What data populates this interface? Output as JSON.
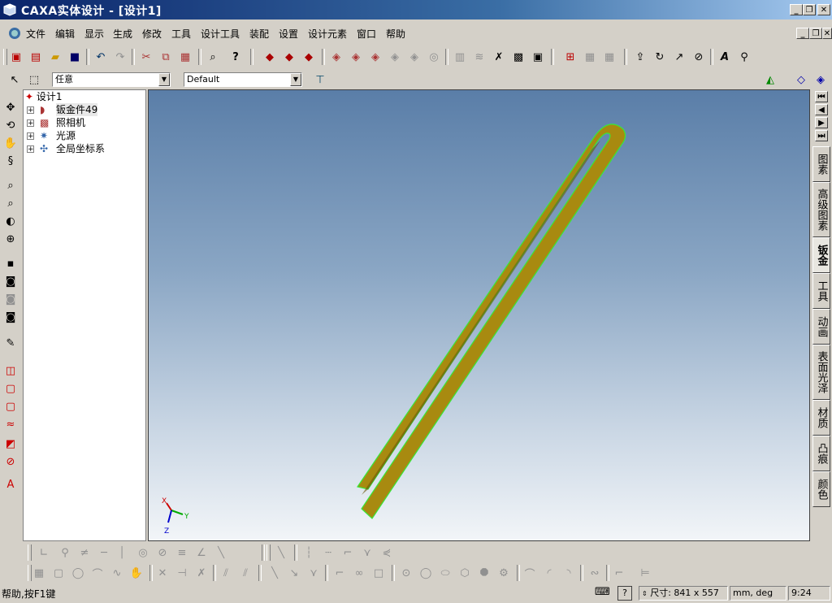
{
  "window": {
    "title": "CAXA实体设计 - [设计1]",
    "controls": [
      "_",
      "❐",
      "✕"
    ]
  },
  "menubar": {
    "items": [
      "文件",
      "编辑",
      "显示",
      "生成",
      "修改",
      "工具",
      "设计工具",
      "装配",
      "设置",
      "设计元素",
      "窗口",
      "帮助"
    ]
  },
  "toolbar2": {
    "filter_value": "任意",
    "view_value": "Default"
  },
  "tree": {
    "root": "设计1",
    "items": [
      {
        "label": "钣金件49",
        "icon": "sheet-metal-icon"
      },
      {
        "label": "照相机",
        "icon": "camera-icon"
      },
      {
        "label": "光源",
        "icon": "light-icon"
      },
      {
        "label": "全局坐标系",
        "icon": "coordinate-system-icon"
      }
    ]
  },
  "viewport": {
    "axes": {
      "x": "X",
      "y": "Y",
      "z": "Z"
    },
    "part_color": "#a88a10",
    "edge_color": "#38e838"
  },
  "right_tabs": {
    "items": [
      "图素",
      "高级图素",
      "钣金",
      "工具",
      "动画",
      "表面光泽",
      "材质",
      "凸痕",
      "颜色"
    ],
    "active": "钣金"
  },
  "statusbar": {
    "help_text": "帮助,按F1键",
    "size_text": "尺寸: 841 x 557",
    "units_text": "mm, deg",
    "time_text": "9:24"
  }
}
